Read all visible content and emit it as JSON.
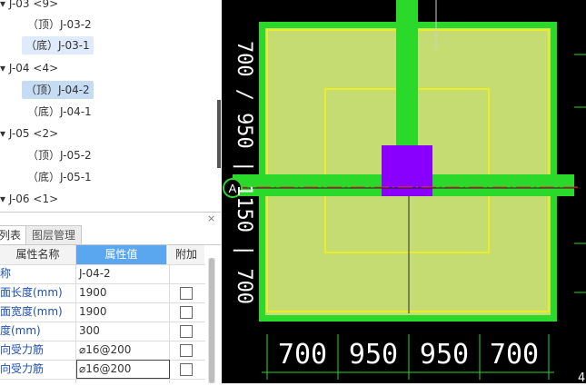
{
  "tree": {
    "items": [
      {
        "label": "J-03 <9>",
        "level": 0
      },
      {
        "label": "（顶）J-03-2",
        "level": 1
      },
      {
        "label": "（底）J-03-1",
        "level": 1,
        "state": "hover"
      },
      {
        "label": "J-04 <4>",
        "level": 0
      },
      {
        "label": "（顶）J-04-2",
        "level": 1,
        "state": "selected"
      },
      {
        "label": "（底）J-04-1",
        "level": 1
      },
      {
        "label": "J-05 <2>",
        "level": 0
      },
      {
        "label": "（顶）J-05-2",
        "level": 1
      },
      {
        "label": "（底）J-05-1",
        "level": 1
      },
      {
        "label": "J-06 <1>",
        "level": 0
      }
    ],
    "expand_glyph": "▾"
  },
  "panel": {
    "close_label": "×",
    "tabs": [
      {
        "label": "列表"
      },
      {
        "label": "图层管理"
      }
    ]
  },
  "props": {
    "headers": {
      "name": "属性名称",
      "value": "属性值",
      "extra": "附加"
    },
    "rows": [
      {
        "name": "名称",
        "value": "J-04-2",
        "has_check": false
      },
      {
        "name": "底面长度(mm)",
        "value": "1900",
        "has_check": true
      },
      {
        "name": "底面宽度(mm)",
        "value": "1900",
        "has_check": true
      },
      {
        "name": "高度(mm)",
        "value": "300",
        "has_check": true
      },
      {
        "name": "横向受力筋",
        "value": "⌀16@200",
        "has_check": true
      },
      {
        "name": "纵向受力筋",
        "value": "⌀16@200",
        "has_check": true,
        "editing": true
      }
    ]
  },
  "cad": {
    "background": "#000000",
    "pad_fill": "#c5dc72",
    "pad_border": "#2bd92b",
    "outline_color": "#f5f50a",
    "beam_color": "#2bd92b",
    "column_color": "#8a00ff",
    "axis_label": "A",
    "vertical_text": "700 / 950 | 1150 | 700",
    "dims": [
      "700",
      "950",
      "950",
      "700"
    ],
    "corner_text": "4"
  }
}
